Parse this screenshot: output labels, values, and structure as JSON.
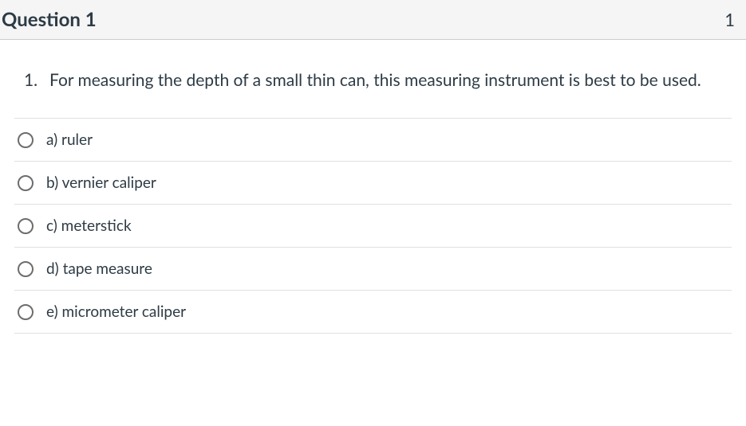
{
  "header": {
    "title": "Question 1",
    "points": "1"
  },
  "question": {
    "number": "1.",
    "text": "For measuring the depth of a small thin can, this measuring instrument is best to be used."
  },
  "answers": [
    {
      "label": "a) ruler"
    },
    {
      "label": "b) vernier caliper"
    },
    {
      "label": "c) meterstick"
    },
    {
      "label": "d) tape measure"
    },
    {
      "label": "e) micrometer caliper"
    }
  ]
}
